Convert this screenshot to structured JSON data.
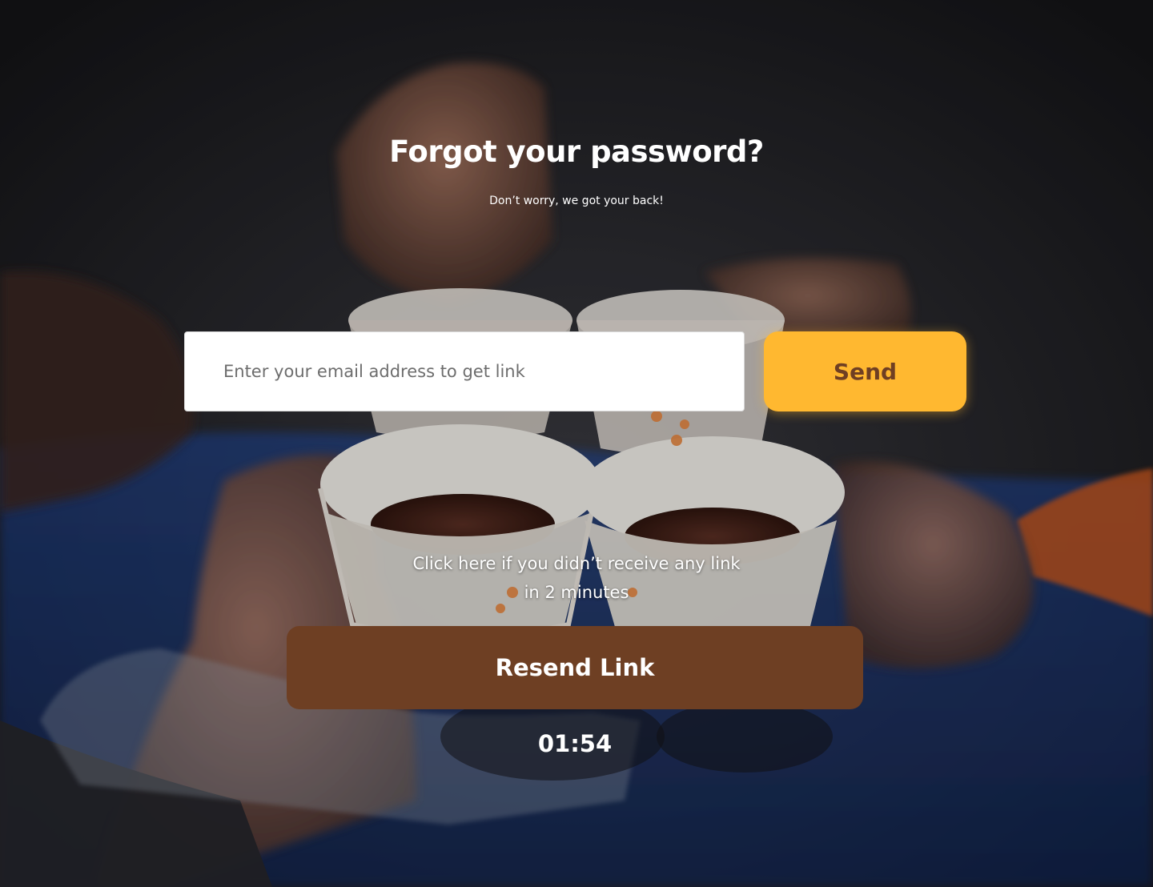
{
  "page": {
    "title": "Forgot your password?",
    "subtitle": "Don’t worry, we got your back!"
  },
  "form": {
    "email_placeholder": "Enter your email address to get link",
    "email_value": "",
    "send_label": "Send"
  },
  "resend": {
    "hint_line1": "Click here if you didn’t receive any link",
    "hint_line2": "in 2 minutes",
    "button_label": "Resend Link",
    "timer": "01:54"
  },
  "colors": {
    "send_button": "#ffb830",
    "send_text": "#6f3f23",
    "resend_button": "#6e3f23",
    "text": "#ffffff"
  }
}
